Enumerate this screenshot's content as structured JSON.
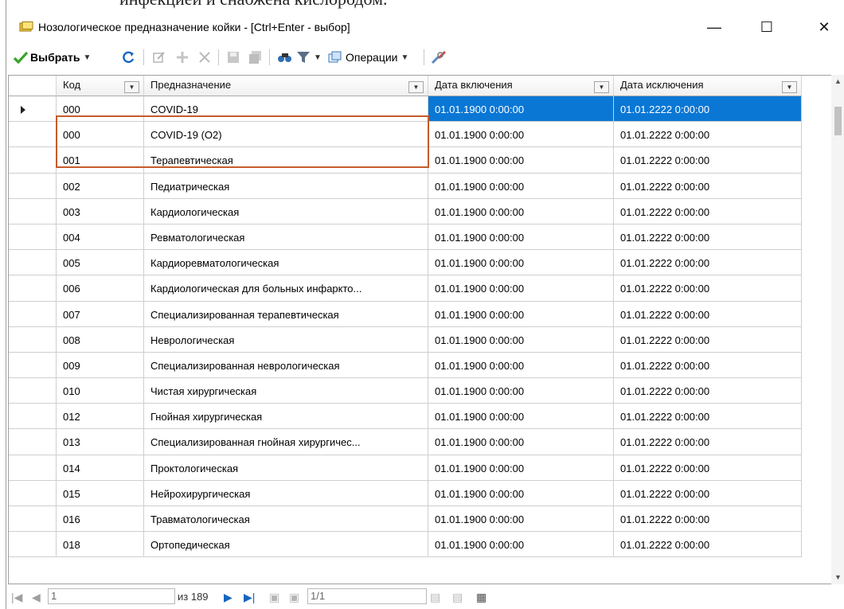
{
  "background": {
    "clipped_text": "инфекцией и снабжена кислородом."
  },
  "window": {
    "title": "Нозологическое предназначение койки - [Ctrl+Enter - выбор]",
    "icon": "window-app-icon",
    "buttons": {
      "minimize": "—",
      "maximize": "☐",
      "close": "✕"
    }
  },
  "toolbar": {
    "select_label": "Выбрать",
    "operations_label": "Операции",
    "icons": [
      "checkmark-icon",
      "refresh-icon",
      "edit-icon",
      "add-icon",
      "delete-icon",
      "save-icon",
      "save-all-icon",
      "find-icon",
      "filter-icon",
      "operations-icon",
      "settings-icon"
    ]
  },
  "grid": {
    "columns": [
      "Код",
      "Предназначение",
      "Дата включения",
      "Дата исключения"
    ],
    "rows": [
      [
        "000",
        "COVID-19",
        "01.01.1900 0:00:00",
        "01.01.2222 0:00:00"
      ],
      [
        "000",
        "COVID-19 (O2)",
        "01.01.1900 0:00:00",
        "01.01.2222 0:00:00"
      ],
      [
        "001",
        "Терапевтическая",
        "01.01.1900 0:00:00",
        "01.01.2222 0:00:00"
      ],
      [
        "002",
        "Педиатрическая",
        "01.01.1900 0:00:00",
        "01.01.2222 0:00:00"
      ],
      [
        "003",
        "Кардиологическая",
        "01.01.1900 0:00:00",
        "01.01.2222 0:00:00"
      ],
      [
        "004",
        "Ревматологическая",
        "01.01.1900 0:00:00",
        "01.01.2222 0:00:00"
      ],
      [
        "005",
        "Кардиоревматологическая",
        "01.01.1900 0:00:00",
        "01.01.2222 0:00:00"
      ],
      [
        "006",
        "Кардиологическая для больных инфаркто...",
        "01.01.1900 0:00:00",
        "01.01.2222 0:00:00"
      ],
      [
        "007",
        "Специализированная терапевтическая",
        "01.01.1900 0:00:00",
        "01.01.2222 0:00:00"
      ],
      [
        "008",
        "Неврологическая",
        "01.01.1900 0:00:00",
        "01.01.2222 0:00:00"
      ],
      [
        "009",
        "Специализированная неврологическая",
        "01.01.1900 0:00:00",
        "01.01.2222 0:00:00"
      ],
      [
        "010",
        "Чистая хирургическая",
        "01.01.1900 0:00:00",
        "01.01.2222 0:00:00"
      ],
      [
        "012",
        "Гнойная хирургическая",
        "01.01.1900 0:00:00",
        "01.01.2222 0:00:00"
      ],
      [
        "013",
        "Специализированная гнойная хирургичес...",
        "01.01.1900 0:00:00",
        "01.01.2222 0:00:00"
      ],
      [
        "014",
        "Проктологическая",
        "01.01.1900 0:00:00",
        "01.01.2222 0:00:00"
      ],
      [
        "015",
        "Нейрохирургическая",
        "01.01.1900 0:00:00",
        "01.01.2222 0:00:00"
      ],
      [
        "016",
        "Травматологическая",
        "01.01.1900 0:00:00",
        "01.01.2222 0:00:00"
      ],
      [
        "018",
        "Ортопедическая",
        "01.01.1900 0:00:00",
        "01.01.2222 0:00:00"
      ]
    ],
    "selected_row": 0
  },
  "navigator": {
    "current_record": "1",
    "total_records": "из 189",
    "page": "1/1"
  },
  "colors": {
    "selection": "#0a77d5",
    "highlight_border": "#c45c2b"
  }
}
